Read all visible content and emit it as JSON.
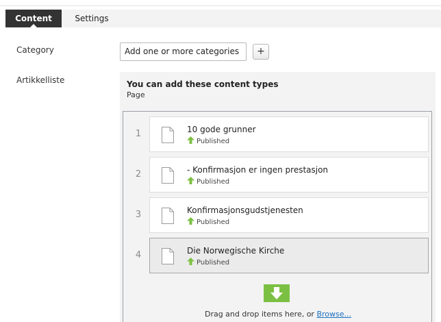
{
  "tabs": {
    "content_label": "Content",
    "settings_label": "Settings"
  },
  "category": {
    "label": "Category",
    "input_value": "Add one or more categories",
    "add_button_label": "+"
  },
  "article_list": {
    "label": "Artikkelliste",
    "panel_title": "You can add these content types",
    "panel_subtitle": "Page",
    "items": [
      {
        "number": "1",
        "title": "10 gode grunner",
        "status": "Published",
        "icon": "page-icon",
        "status_icon": "published-up-arrow-icon"
      },
      {
        "number": "2",
        "title": "- Konfirmasjon er ingen prestasjon",
        "status": "Published",
        "icon": "page-icon",
        "status_icon": "published-up-arrow-icon"
      },
      {
        "number": "3",
        "title": "Konfirmasjonsgudstjenesten",
        "status": "Published",
        "icon": "page-icon",
        "status_icon": "published-up-arrow-icon"
      },
      {
        "number": "4",
        "title": "Die Norwegische Kirche",
        "status": "Published",
        "icon": "page-icon",
        "status_icon": "published-up-arrow-icon"
      }
    ],
    "drop_text": "Drag and drop items here, or ",
    "browse_link": "Browse..."
  },
  "colors": {
    "active_tab_bg": "#333333",
    "published_green": "#7cc043",
    "link_blue": "#1a6fbf"
  }
}
